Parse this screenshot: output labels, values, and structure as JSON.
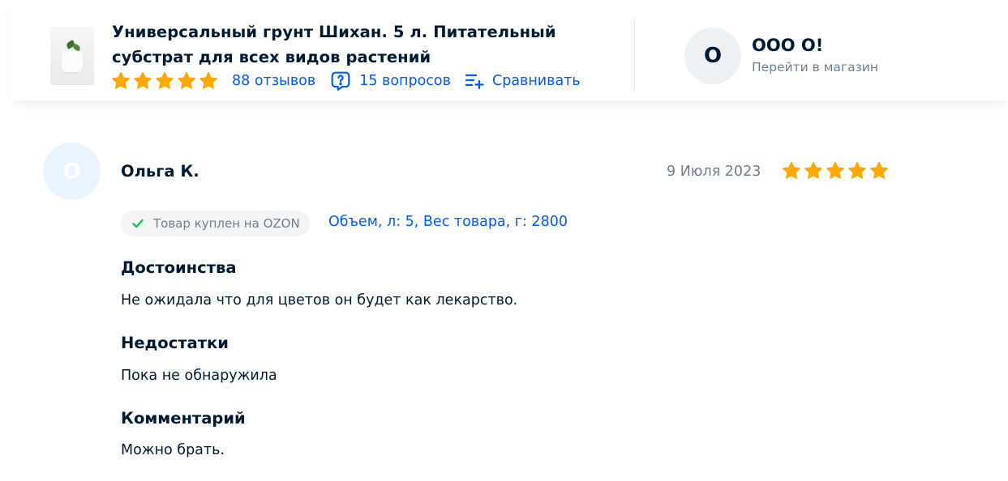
{
  "product": {
    "title": "Универсальный грунт Шихан. 5 л. Питательный субстрат для всех видов растений",
    "rating_stars": 5,
    "reviews_label": "88 отзывов",
    "questions_label": "15 вопросов",
    "compare_label": "Сравнивать"
  },
  "store": {
    "avatar_letter": "O",
    "name": "ООО О!",
    "link_label": "Перейти в магазин"
  },
  "review": {
    "avatar_letter": "O",
    "author": "Ольга К.",
    "date": "9 Июля 2023",
    "rating_stars": 5,
    "badge_label": "Товар куплен на OZON",
    "variant": "Объем, л: 5, Вес товара, г: 2800",
    "pros_heading": "Достоинства",
    "pros_text": "Не ожидала что для цветов он будет как лекарство.",
    "cons_heading": "Недостатки",
    "cons_text": "Пока не обнаружила",
    "comment_heading": "Комментарий",
    "comment_text": "Можно брать."
  },
  "colors": {
    "link": "#005bff",
    "star": "#ffa800",
    "text": "#001a34",
    "muted": "#707f8d",
    "check": "#10c44c"
  },
  "icons": {
    "questions": "question-bubble-icon",
    "compare": "compare-list-icon",
    "badge": "check-icon",
    "star": "star-icon"
  }
}
